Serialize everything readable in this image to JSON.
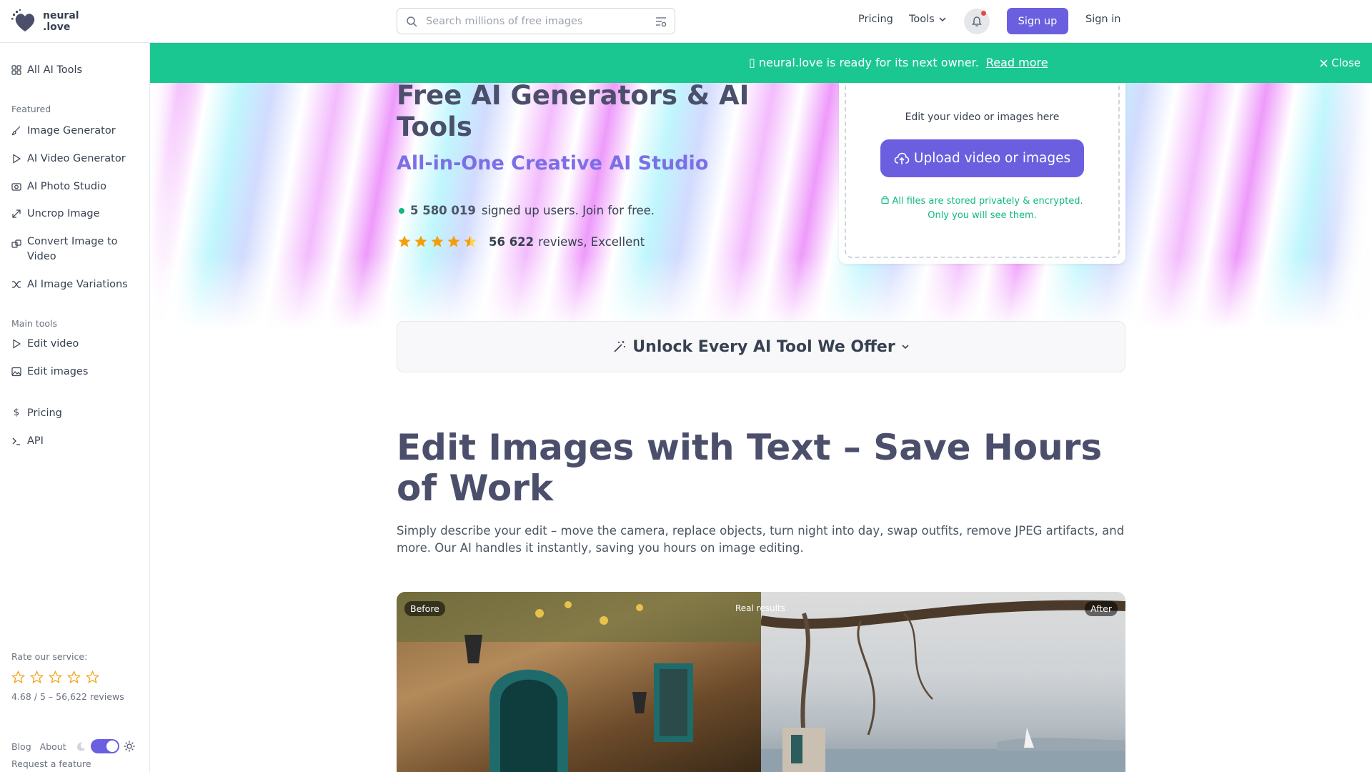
{
  "header": {
    "logo_line1": "neural",
    "logo_line2": ".love",
    "search_placeholder": "Search millions of free images",
    "nav_pricing": "Pricing",
    "nav_tools": "Tools",
    "signup": "Sign up",
    "signin": "Sign in"
  },
  "sidebar": {
    "all_tools": "All AI Tools",
    "featured_label": "Featured",
    "featured": [
      {
        "label": "Image Generator",
        "icon": "brush-icon"
      },
      {
        "label": "AI Video Generator",
        "icon": "play-icon"
      },
      {
        "label": "AI Photo Studio",
        "icon": "camera-icon"
      },
      {
        "label": "Uncrop Image",
        "icon": "expand-icon"
      },
      {
        "label": "Convert Image to Video",
        "icon": "convert-icon"
      },
      {
        "label": "AI Image Variations",
        "icon": "shuffle-icon"
      }
    ],
    "main_tools_label": "Main tools",
    "main_tools": [
      {
        "label": "Edit video",
        "icon": "play-icon"
      },
      {
        "label": "Edit images",
        "icon": "image-icon"
      }
    ],
    "pricing": "Pricing",
    "api": "API",
    "rate_label": "Rate our service:",
    "rate_summary": "4.68 / 5 – 56,622 reviews",
    "blog": "Blog",
    "about": "About",
    "request": "Request a feature"
  },
  "banner": {
    "icon_glyph": "▯",
    "text": "neural.love is ready for its next owner.",
    "link": "Read more",
    "close": "Close"
  },
  "hero": {
    "title": "Free AI Generators & AI Tools",
    "subtitle": "All-in-One Creative AI Studio",
    "users_count": "5 580 019",
    "users_text": "signed up users. Join for free.",
    "review_count": "56 622",
    "review_text": "reviews, Excellent",
    "rating_stars": 4.5
  },
  "upload": {
    "hint": "Edit your video or images here",
    "button": "Upload video or images",
    "privacy_line1": "All files are stored privately & encrypted.",
    "privacy_line2": "Only you will see them."
  },
  "unlock": {
    "label": "Unlock Every AI Tool We Offer"
  },
  "section": {
    "title": "Edit Images with Text – Save Hours of Work",
    "description": "Simply describe your edit – move the camera, replace objects, turn night into day, swap outfits, remove JPEG artifacts, and more. Our AI handles it instantly, saving you hours on image editing.",
    "before": "Before",
    "after": "After",
    "real": "Real results"
  },
  "colors": {
    "accent": "#6b5fe0",
    "banner": "#1bc790",
    "heading": "#4b4f6b",
    "star": "#f59e0b"
  }
}
